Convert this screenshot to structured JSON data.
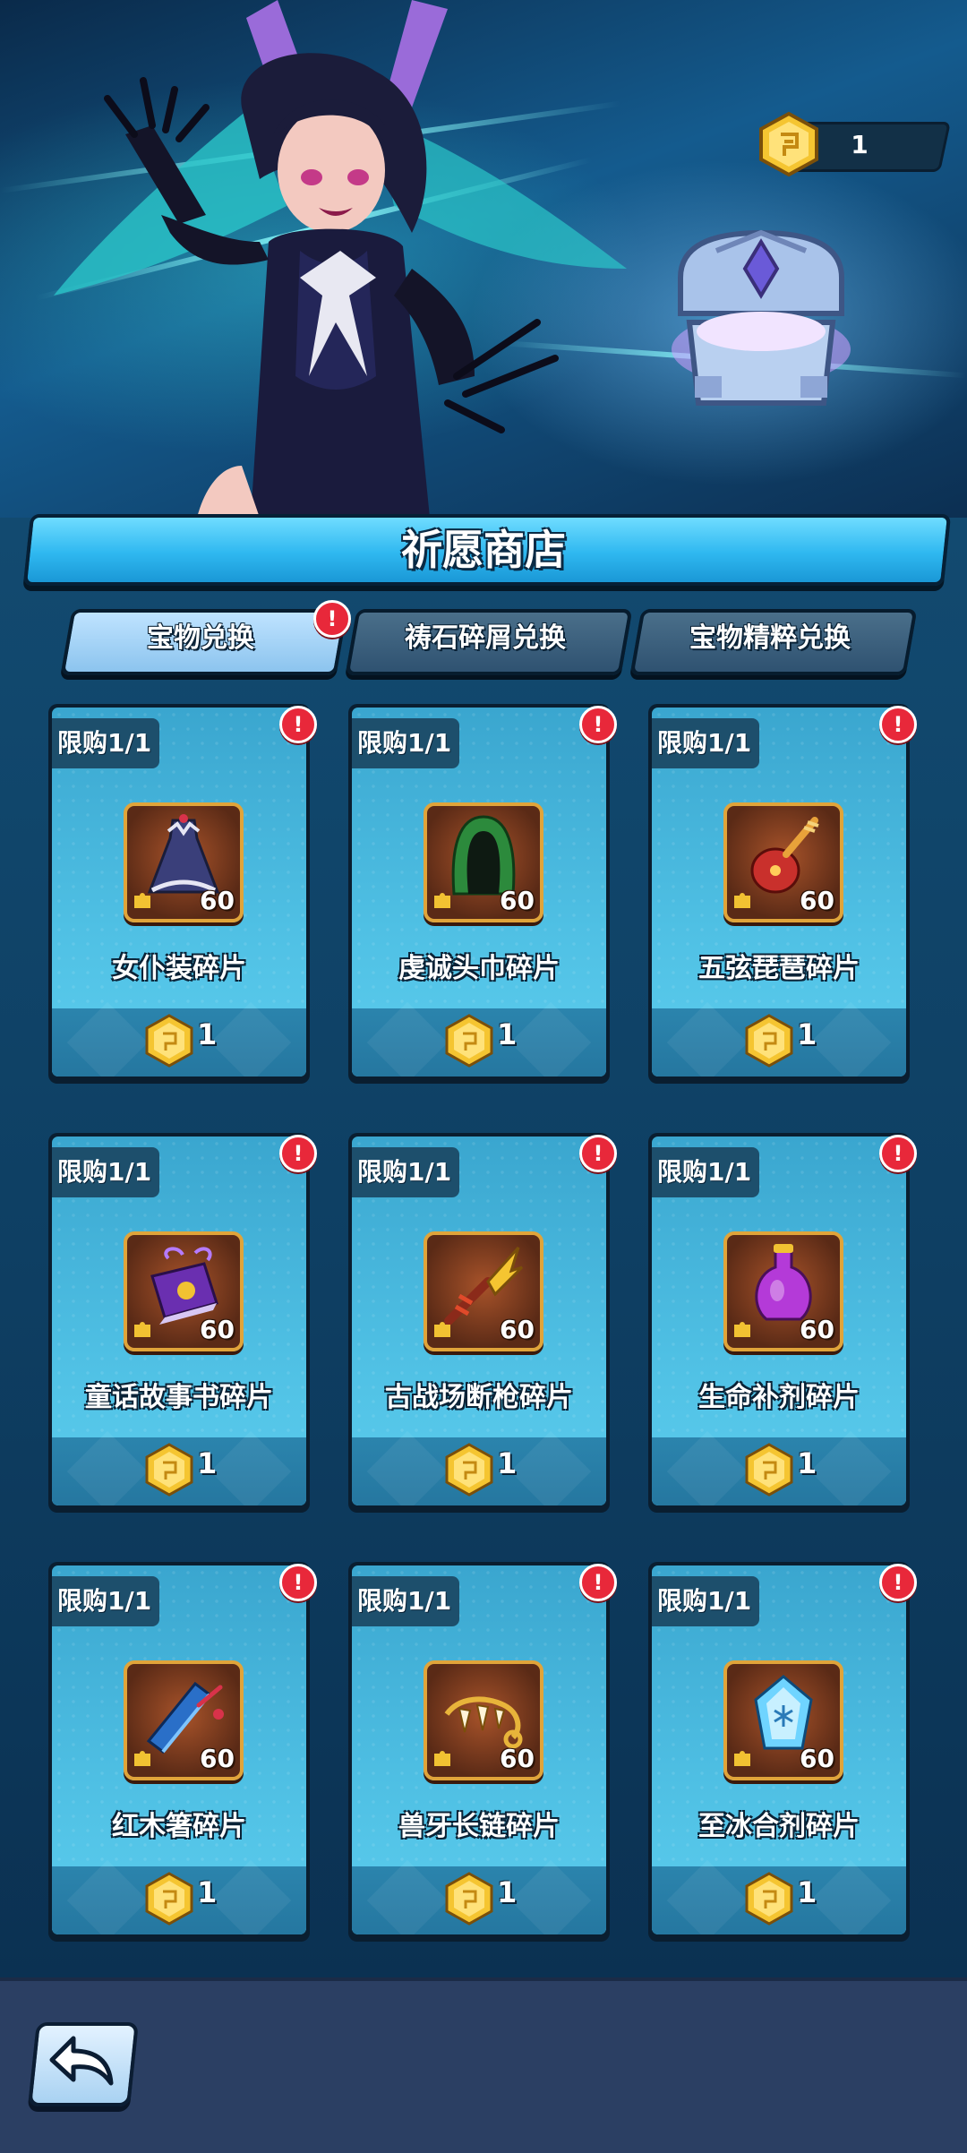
{
  "currency": {
    "count": "1",
    "icon": "gold-coin-icon"
  },
  "title": "祈愿商店",
  "tabs": [
    {
      "label": "宝物兑换",
      "active": true,
      "alert": "!"
    },
    {
      "label": "祷石碎屑兑换",
      "active": false
    },
    {
      "label": "宝物精粹兑换",
      "active": false
    }
  ],
  "items": [
    {
      "limit": "限购1/1",
      "name": "女仆装碎片",
      "qty": "60",
      "price": "1",
      "alert": "!",
      "icon": "maid-dress-icon"
    },
    {
      "limit": "限购1/1",
      "name": "虔诚头巾碎片",
      "qty": "60",
      "price": "1",
      "alert": "!",
      "icon": "hood-icon"
    },
    {
      "limit": "限购1/1",
      "name": "五弦琵琶碎片",
      "qty": "60",
      "price": "1",
      "alert": "!",
      "icon": "pipa-icon"
    },
    {
      "limit": "限购1/1",
      "name": "童话故事书碎片",
      "qty": "60",
      "price": "1",
      "alert": "!",
      "icon": "storybook-icon"
    },
    {
      "limit": "限购1/1",
      "name": "古战场断枪碎片",
      "qty": "60",
      "price": "1",
      "alert": "!",
      "icon": "broken-spear-icon"
    },
    {
      "limit": "限购1/1",
      "name": "生命补剂碎片",
      "qty": "60",
      "price": "1",
      "alert": "!",
      "icon": "potion-icon"
    },
    {
      "limit": "限购1/1",
      "name": "红木箸碎片",
      "qty": "60",
      "price": "1",
      "alert": "!",
      "icon": "chopsticks-icon"
    },
    {
      "limit": "限购1/1",
      "name": "兽牙长链碎片",
      "qty": "60",
      "price": "1",
      "alert": "!",
      "icon": "fang-chain-icon"
    },
    {
      "limit": "限购1/1",
      "name": "至冰合剂碎片",
      "qty": "60",
      "price": "1",
      "alert": "!",
      "icon": "ice-crystal-icon"
    }
  ],
  "colors": {
    "accent": "#2fb8f0",
    "alert": "#e8283a",
    "coin": "#f5c531",
    "frame": "#e0a43a"
  }
}
